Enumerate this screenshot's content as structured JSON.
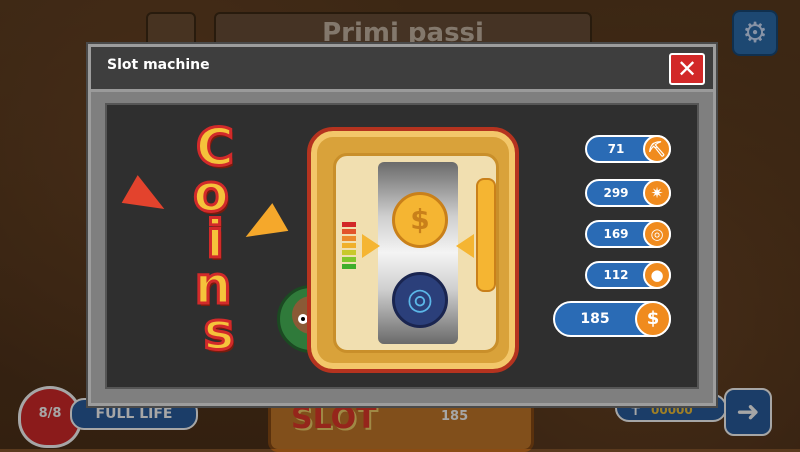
{
  "background": {
    "title": "Primi passi",
    "heart_label": "8/8",
    "full_life_label": "FULL LIFE",
    "slot_label": "SLOT",
    "slot_cost": "185",
    "tomb_value": "00000"
  },
  "dialog": {
    "title": "Slot machine",
    "close_symbol": "✕"
  },
  "sign": {
    "letters": [
      "C",
      "o",
      "i",
      "n",
      "s"
    ]
  },
  "rewards": [
    {
      "count": "71",
      "icon": "pickaxe-icon",
      "glyph": "⛏"
    },
    {
      "count": "299",
      "icon": "burst-icon",
      "glyph": "✷"
    },
    {
      "count": "169",
      "icon": "swirl-icon",
      "glyph": "◎"
    },
    {
      "count": "112",
      "icon": "bomb-icon",
      "glyph": "●"
    },
    {
      "count": "185",
      "icon": "coin-icon",
      "glyph": "$"
    }
  ],
  "reels": {
    "top_symbol": "$",
    "bottom_symbol": "◎"
  },
  "colors": {
    "accent_blue": "#2a6bb5",
    "close_red": "#d22828",
    "coin_gold": "#f5b532"
  }
}
